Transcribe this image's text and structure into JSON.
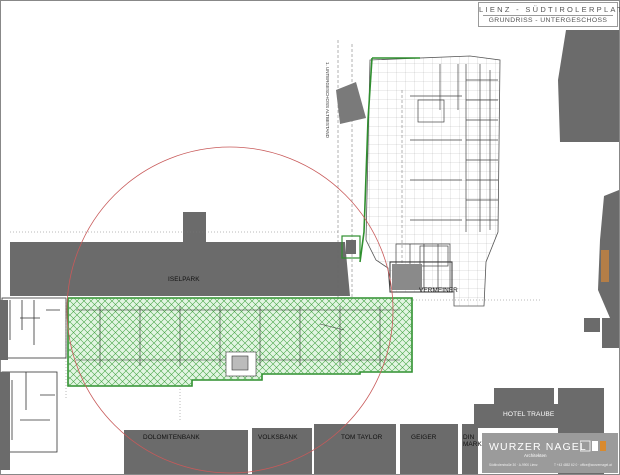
{
  "title": {
    "line1": "LIENZ - SÜDTIROLERPLAT",
    "line2": "GRUNDRISS - UNTERGESCHOSS"
  },
  "labels": {
    "iselpark": "ISELPARK",
    "dolomitenbank": "DOLOMITENBANK",
    "volksbank": "VOLKSBANK",
    "tom_taylor": "TOM TAYLOR",
    "geiger": "GEIGER",
    "din_mark": "DIN MARK",
    "hotel_traube": "HOTEL TRAUBE",
    "hauptgebaeude": "VERMEINER",
    "vertical_note": "1. UNTERGESCHOSS ALTBESTAND"
  },
  "logo": {
    "name": "WURZER NAGEL",
    "subtitle": "Architekten",
    "address_left": "Südtirolerstraße 30 · A-9900 Lienz",
    "address_right": "T +43 4852 62 0 · office@wurzernagel.at"
  },
  "colors": {
    "building_gray": "#6b6b6b",
    "garage_green": "#3f9e3f",
    "garage_fill": "#d7f0d7",
    "radius_circle": "#c85a5a",
    "logo_bg": "#9b9b9b"
  }
}
